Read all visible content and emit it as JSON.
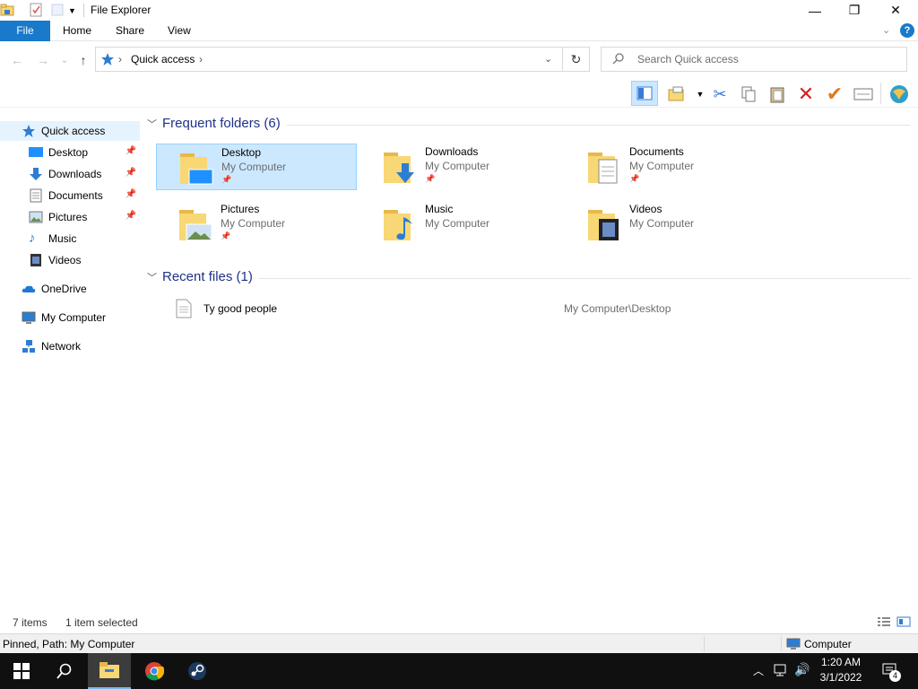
{
  "window": {
    "title": "File Explorer",
    "minimize_glyph": "—",
    "maximize_glyph": "❐",
    "close_glyph": "✕"
  },
  "ribbon": {
    "tabs": [
      "File",
      "Home",
      "Share",
      "View"
    ],
    "help_glyph": "?"
  },
  "nav": {
    "back_glyph": "←",
    "forward_glyph": "→",
    "recent_glyph": "⌄",
    "up_glyph": "↑",
    "location": "Quick access",
    "refresh_glyph": "↻",
    "search_placeholder": "Search Quick access"
  },
  "toolbar": {
    "icons": [
      "preview-pane-icon",
      "new-folder-icon",
      "cut-icon",
      "copy-icon",
      "paste-icon",
      "delete-icon",
      "rename-icon",
      "properties-icon",
      "globe-icon"
    ]
  },
  "sidebar": {
    "items": [
      {
        "label": "Quick access",
        "icon": "star-icon",
        "pinned": false
      },
      {
        "label": "Desktop",
        "icon": "desktop-icon",
        "pinned": true
      },
      {
        "label": "Downloads",
        "icon": "download-icon",
        "pinned": true
      },
      {
        "label": "Documents",
        "icon": "document-icon",
        "pinned": true
      },
      {
        "label": "Pictures",
        "icon": "picture-icon",
        "pinned": true
      },
      {
        "label": "Music",
        "icon": "music-icon",
        "pinned": false
      },
      {
        "label": "Videos",
        "icon": "video-icon",
        "pinned": false
      },
      {
        "label": "OneDrive",
        "icon": "cloud-icon",
        "pinned": false
      },
      {
        "label": "My Computer",
        "icon": "computer-icon",
        "pinned": false
      },
      {
        "label": "Network",
        "icon": "network-icon",
        "pinned": false
      }
    ]
  },
  "frequent": {
    "header": "Frequent folders (6)",
    "folders": [
      {
        "name": "Desktop",
        "location": "My Computer",
        "pinned": true,
        "selected": true
      },
      {
        "name": "Downloads",
        "location": "My Computer",
        "pinned": true,
        "selected": false
      },
      {
        "name": "Documents",
        "location": "My Computer",
        "pinned": true,
        "selected": false
      },
      {
        "name": "Pictures",
        "location": "My Computer",
        "pinned": true,
        "selected": false
      },
      {
        "name": "Music",
        "location": "My Computer",
        "pinned": false,
        "selected": false
      },
      {
        "name": "Videos",
        "location": "My Computer",
        "pinned": false,
        "selected": false
      }
    ]
  },
  "recent": {
    "header": "Recent files (1)",
    "files": [
      {
        "name": "Ty good people",
        "path": "My Computer\\Desktop"
      }
    ]
  },
  "status": {
    "item_count": "7 items",
    "selection": "1 item selected"
  },
  "details": {
    "left": "Pinned, Path: My Computer",
    "right": "Computer"
  },
  "taskbar": {
    "time": "1:20 AM",
    "date": "3/1/2022",
    "notifications": "4"
  },
  "colors": {
    "accent": "#1979ca",
    "selection_bg": "#cce8ff",
    "group_header": "#1e3287",
    "folder": "#f8d775",
    "taskbar": "#101010"
  }
}
